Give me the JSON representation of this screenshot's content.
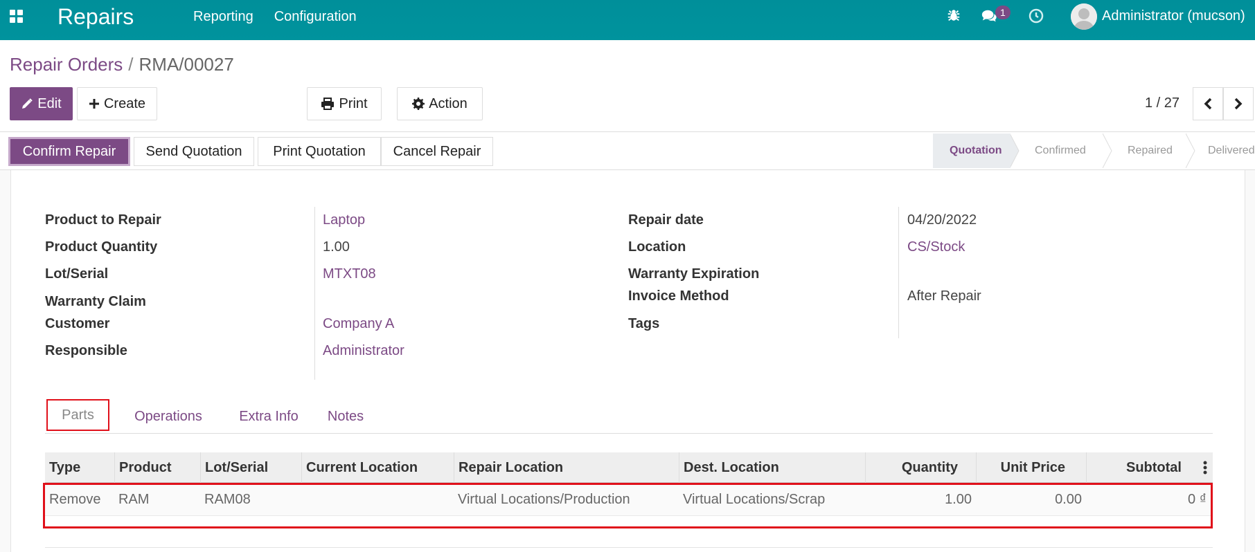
{
  "navbar": {
    "brand": "Repairs",
    "menu": [
      "Reporting",
      "Configuration"
    ],
    "messages_count": "1",
    "user": "Administrator (mucson)"
  },
  "breadcrumb": {
    "parent": "Repair Orders",
    "separator": "/",
    "current": "RMA/00027"
  },
  "toolbar": {
    "edit": "Edit",
    "create": "Create",
    "print": "Print",
    "action": "Action"
  },
  "pager": {
    "value": "1 / 27"
  },
  "statusbar": {
    "buttons": [
      "Confirm Repair",
      "Send Quotation",
      "Print Quotation",
      "Cancel Repair"
    ],
    "stages": [
      "Quotation",
      "Confirmed",
      "Repaired",
      "Delivered"
    ],
    "active_stage": "Quotation"
  },
  "form": {
    "left": [
      {
        "label": "Product to Repair",
        "value": "Laptop"
      },
      {
        "label": "Product Quantity",
        "value": "1.00"
      },
      {
        "label": "Lot/Serial",
        "value": "MTXT08"
      },
      {
        "label": "Warranty Claim",
        "value": ""
      },
      {
        "label": "Customer",
        "value": "Company A"
      },
      {
        "label": "Responsible",
        "value": "Administrator"
      }
    ],
    "right": [
      {
        "label": "Repair date",
        "value": "04/20/2022"
      },
      {
        "label": "Location",
        "value": "CS/Stock"
      },
      {
        "label": "Warranty Expiration",
        "value": ""
      },
      {
        "label": "Invoice Method",
        "value": "After Repair"
      },
      {
        "label": "Tags",
        "value": ""
      }
    ]
  },
  "tabs": [
    "Parts",
    "Operations",
    "Extra Info",
    "Notes"
  ],
  "parts_table": {
    "columns": [
      "Type",
      "Product",
      "Lot/Serial",
      "Current Location",
      "Repair Location",
      "Dest. Location",
      "Quantity",
      "Unit Price",
      "Subtotal"
    ],
    "rows": [
      {
        "type": "Remove",
        "product": "RAM",
        "lot": "RAM08",
        "current_location": "",
        "repair_location": "Virtual Locations/Production",
        "dest_location": "Virtual Locations/Scrap",
        "quantity": "1.00",
        "unit_price": "0.00",
        "subtotal": "0 ₫"
      }
    ]
  },
  "colors": {
    "navbar": "#00939d",
    "primary": "#7c4a85",
    "highlight": "#e0101a"
  }
}
